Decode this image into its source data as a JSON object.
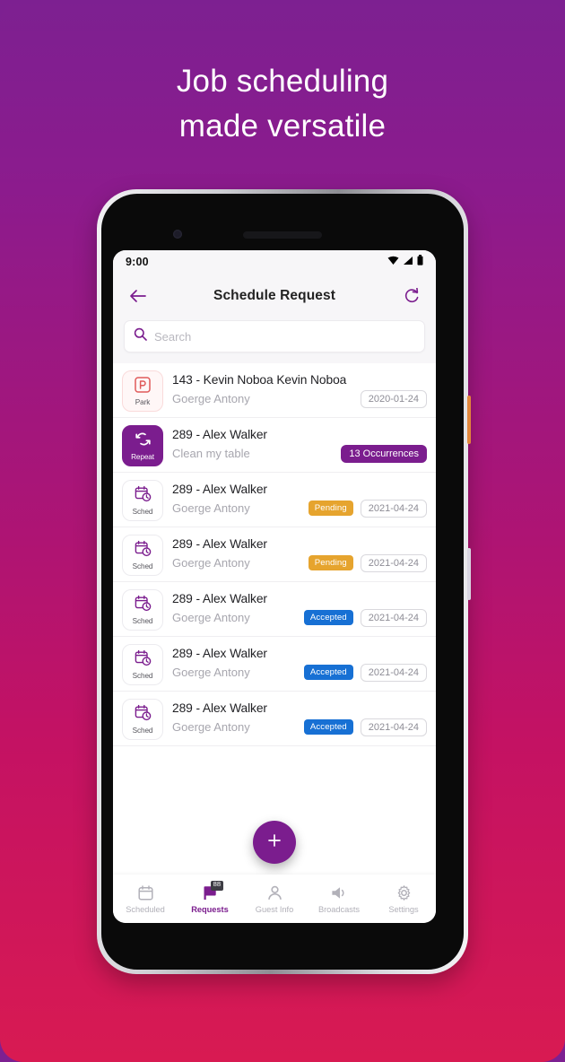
{
  "promo": {
    "headline_line1": "Job scheduling",
    "headline_line2": "made versatile",
    "bg_top": "#7d2091",
    "bg_bottom": "#d81a52"
  },
  "status_bar": {
    "time": "9:00",
    "icons": [
      "wifi-icon",
      "signal-icon",
      "battery-icon"
    ]
  },
  "app_bar": {
    "back_icon": "back-arrow-icon",
    "title": "Schedule Request",
    "refresh_icon": "refresh-icon"
  },
  "search": {
    "placeholder": "Search",
    "value": "",
    "icon": "search-icon"
  },
  "list": {
    "rows": [
      {
        "tile_type": "park",
        "tile_label": "Park",
        "tile_icon": "parking-p-icon",
        "title": "143 - Kevin Noboa Kevin Noboa",
        "subtitle": "Goerge Antony",
        "badge": null,
        "badge_type": null,
        "occurrences": null,
        "date": "2020-01-24"
      },
      {
        "tile_type": "repeat",
        "tile_label": "Repeat",
        "tile_icon": "repeat-icon",
        "title": "289 - Alex Walker",
        "subtitle": "Clean my table",
        "badge": null,
        "badge_type": null,
        "occurrences": "13 Occurrences",
        "date": null
      },
      {
        "tile_type": "sched",
        "tile_label": "Sched",
        "tile_icon": "calendar-clock-icon",
        "title": "289 - Alex Walker",
        "subtitle": "Goerge Antony",
        "badge": "Pending",
        "badge_type": "pending",
        "occurrences": null,
        "date": "2021-04-24"
      },
      {
        "tile_type": "sched",
        "tile_label": "Sched",
        "tile_icon": "calendar-clock-icon",
        "title": "289 - Alex Walker",
        "subtitle": "Goerge Antony",
        "badge": "Pending",
        "badge_type": "pending",
        "occurrences": null,
        "date": "2021-04-24"
      },
      {
        "tile_type": "sched",
        "tile_label": "Sched",
        "tile_icon": "calendar-clock-icon",
        "title": "289 - Alex Walker",
        "subtitle": "Goerge Antony",
        "badge": "Accepted",
        "badge_type": "accepted",
        "occurrences": null,
        "date": "2021-04-24"
      },
      {
        "tile_type": "sched",
        "tile_label": "Sched",
        "tile_icon": "calendar-clock-icon",
        "title": "289 - Alex Walker",
        "subtitle": "Goerge Antony",
        "badge": "Accepted",
        "badge_type": "accepted",
        "occurrences": null,
        "date": "2021-04-24"
      },
      {
        "tile_type": "sched",
        "tile_label": "Sched",
        "tile_icon": "calendar-clock-icon",
        "title": "289 - Alex Walker",
        "subtitle": "Goerge Antony",
        "badge": "Accepted",
        "badge_type": "accepted",
        "occurrences": null,
        "date": "2021-04-24"
      }
    ]
  },
  "fab": {
    "icon": "plus-icon",
    "label": "+"
  },
  "bottom_nav": {
    "items": [
      {
        "label": "Scheduled",
        "icon": "calendar-icon",
        "active": false,
        "badge": null
      },
      {
        "label": "Requests",
        "icon": "request-flag-icon",
        "active": true,
        "badge": "88"
      },
      {
        "label": "Guest Info",
        "icon": "person-icon",
        "active": false,
        "badge": null
      },
      {
        "label": "Broadcasts",
        "icon": "speaker-icon",
        "active": false,
        "badge": null
      },
      {
        "label": "Settings",
        "icon": "gear-icon",
        "active": false,
        "badge": null
      }
    ]
  },
  "theme": {
    "accent": "#7b1d8e",
    "pending": "#e6a42e",
    "accepted": "#1770d4",
    "park": "#e05a5a"
  }
}
